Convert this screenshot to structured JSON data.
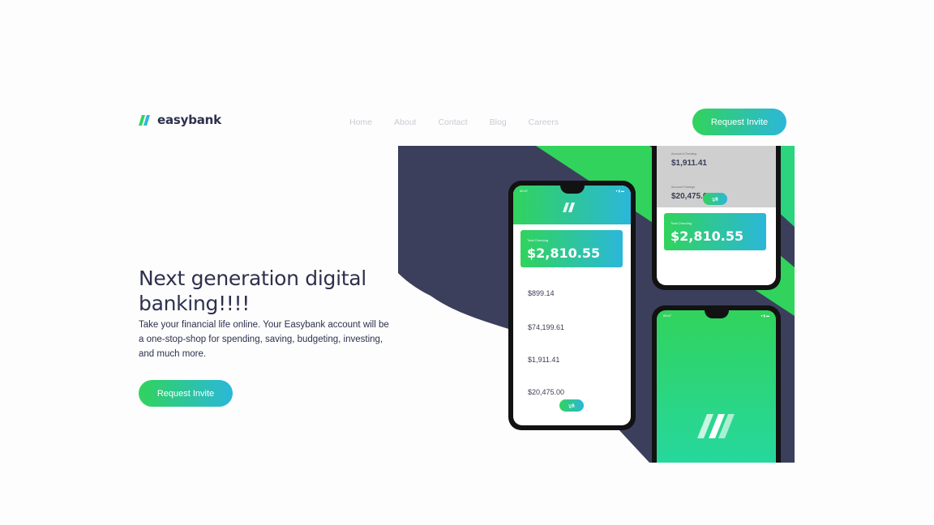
{
  "brand": {
    "name": "easybank"
  },
  "nav": {
    "items": [
      "Home",
      "About",
      "Contact",
      "Blog",
      "Careers"
    ]
  },
  "header": {
    "cta_label": "Request Invite"
  },
  "hero": {
    "title": "Next generation digital banking!!!!",
    "description": "Take your financial life online. Your Easybank account will be a one-stop-shop for spending, saving, budgeting, investing, and much more.",
    "cta_label": "Request Invite"
  },
  "phone_left": {
    "status_time": "09:47",
    "card_label": "Total Checking",
    "card_amount": "$2,810.55",
    "transactions": [
      "$899.14",
      "$74,199.61",
      "$1,911.41",
      "$20,475.00"
    ]
  },
  "phone_right_top": {
    "accounts": [
      {
        "label": "Account # Checking",
        "amount": "$1,911.41"
      },
      {
        "label": "Account # Savings",
        "amount": "$20,475.00"
      }
    ],
    "card_label": "Total Checking",
    "card_amount": "$2,810.55"
  },
  "phone_right_bottom": {
    "status_time": "09:47"
  },
  "colors": {
    "navy": "#2d314d",
    "lime_green": "#31d35c",
    "bright_cyan": "#2bb7da",
    "dark_blue_shape": "#3b3f5c"
  }
}
